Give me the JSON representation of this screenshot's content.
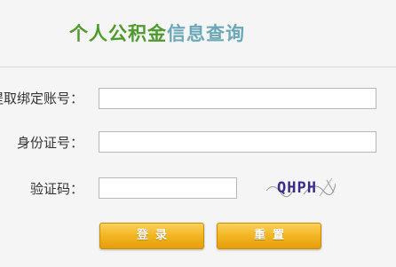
{
  "header": {
    "title_part1": "个人公积金",
    "title_part2": "信息查询"
  },
  "form": {
    "account": {
      "label": "提取绑定账号：",
      "value": ""
    },
    "id_number": {
      "label": "身份证号：",
      "value": ""
    },
    "captcha": {
      "label": "验证码：",
      "value": "",
      "image_text": "QHPH"
    }
  },
  "buttons": {
    "login": "登录",
    "reset": "重置"
  },
  "colors": {
    "title_green": "#4e9a2c",
    "title_blue": "#6aa8b8",
    "button_gold": "#f2b522"
  }
}
